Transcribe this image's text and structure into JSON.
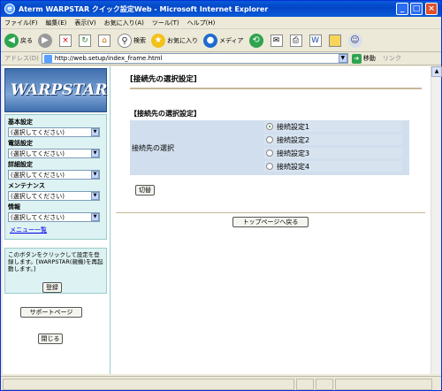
{
  "window": {
    "title": "Aterm WARPSTAR クイック設定Web - Microsoft Internet Explorer"
  },
  "menu": [
    "ファイル(F)",
    "編集(E)",
    "表示(V)",
    "お気に入り(A)",
    "ツール(T)",
    "ヘルプ(H)"
  ],
  "toolbar": {
    "back": "戻る",
    "search": "検索",
    "favorites": "お気に入り",
    "media": "メディア"
  },
  "address": {
    "label": "アドレス(D)",
    "url": "http://web.setup/index_frame.html",
    "go": "移動",
    "links": "リンク"
  },
  "sidebar": {
    "logo": "WARPSTAR",
    "sections": [
      {
        "label": "基本設定",
        "value": "(選択してください)"
      },
      {
        "label": "電話設定",
        "value": "(選択してください)"
      },
      {
        "label": "詳細設定",
        "value": "(選択してください)"
      },
      {
        "label": "メンテナンス",
        "value": "(選択してください)"
      },
      {
        "label": "情報",
        "value": "(選択してください)"
      }
    ],
    "menu_list": "メニュー一覧",
    "info_text": "このボタンをクリックして設定を登録します。[WARPSTAR(親機)を再起動します。]",
    "register": "登録",
    "support": "サポートページ",
    "close": "閉じる"
  },
  "main": {
    "page_title": "[接続先の選択設定]",
    "section_title": "【接続先の選択設定】",
    "row_label": "接続先の選択",
    "options": [
      "接続設定1",
      "接続設定2",
      "接続設定3",
      "接続設定4"
    ],
    "selected": "接続設定1",
    "switch": "切替",
    "top_page": "トップページへ戻る"
  }
}
